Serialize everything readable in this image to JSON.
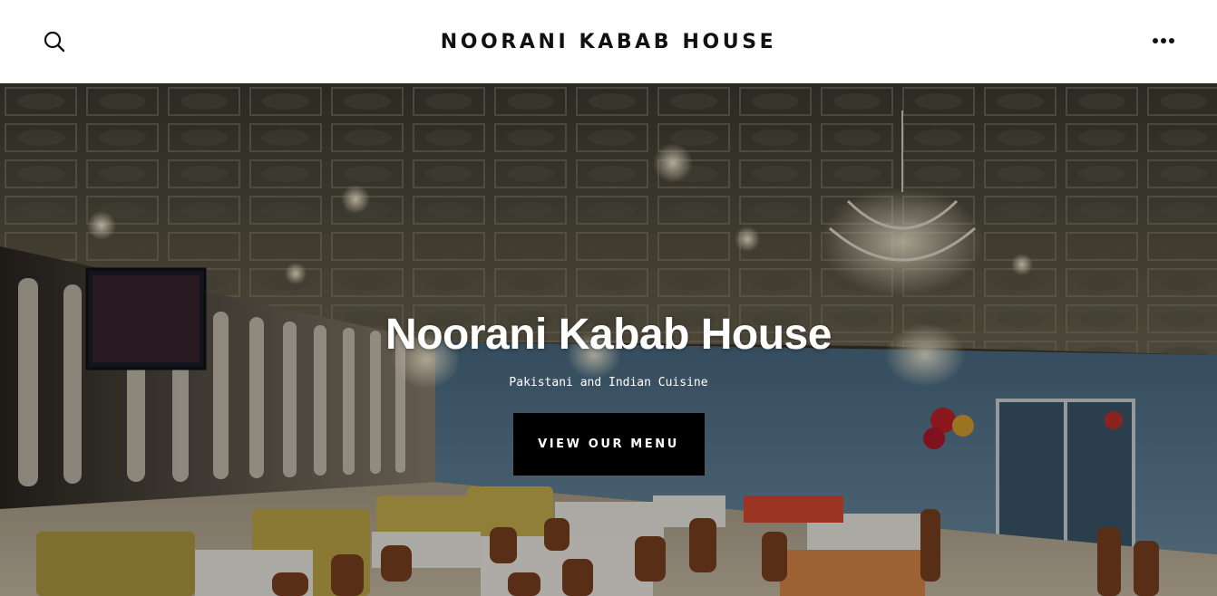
{
  "header": {
    "site_title": "NOORANI KABAB HOUSE",
    "search_icon": "search-icon",
    "menu_icon": "more-dots-icon"
  },
  "hero": {
    "title": "Noorani Kabab House",
    "tagline": "Pakistani and Indian Cuisine",
    "cta_label": "VIEW OUR MENU",
    "background": "restaurant-dining-room-photo"
  },
  "colors": {
    "header_bg": "#ffffff",
    "title_text": "#111111",
    "button_bg": "#000000",
    "button_text": "#ffffff"
  }
}
